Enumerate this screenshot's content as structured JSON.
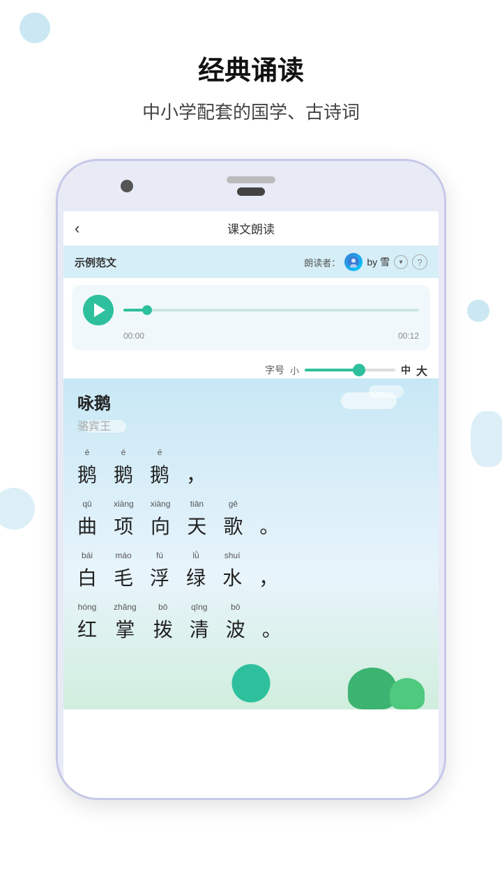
{
  "page": {
    "main_title": "经典诵读",
    "sub_title": "中小学配套的国学、古诗词"
  },
  "app": {
    "navbar": {
      "back_label": "‹",
      "title": "课文朗读"
    },
    "reader_bar": {
      "section_label": "示例范文",
      "reader_prefix": "朗读者：",
      "reader_name": "by 雪",
      "help_icon": "?"
    },
    "audio": {
      "play_icon": "play",
      "time_current": "00:00",
      "time_total": "00:12"
    },
    "font_size": {
      "label": "字号",
      "small": "小",
      "medium": "中",
      "large": "大"
    },
    "poem": {
      "title": "咏鹅",
      "author": "骆宾王",
      "lines": [
        {
          "chars": [
            "鹅",
            "鹅",
            "鹅",
            "，"
          ],
          "pinyins": [
            "é",
            "é",
            "é",
            ""
          ]
        },
        {
          "chars": [
            "曲",
            "项",
            "向",
            "天",
            "歌",
            "。"
          ],
          "pinyins": [
            "qū",
            "xiàng",
            "xiàng",
            "tiān",
            "gē",
            ""
          ]
        },
        {
          "chars": [
            "白",
            "毛",
            "浮",
            "绿",
            "水",
            "，"
          ],
          "pinyins": [
            "bái",
            "máo",
            "fú",
            "lǜ",
            "shuí",
            ""
          ]
        },
        {
          "chars": [
            "红",
            "掌",
            "拨",
            "清",
            "波",
            "。"
          ],
          "pinyins": [
            "hóng",
            "zhǎng",
            "bō",
            "qīng",
            "bō",
            ""
          ]
        }
      ]
    }
  },
  "colors": {
    "accent": "#2ec09d",
    "sky_bg": "#c8e8f5",
    "reader_bar_bg": "#d6eef7"
  }
}
